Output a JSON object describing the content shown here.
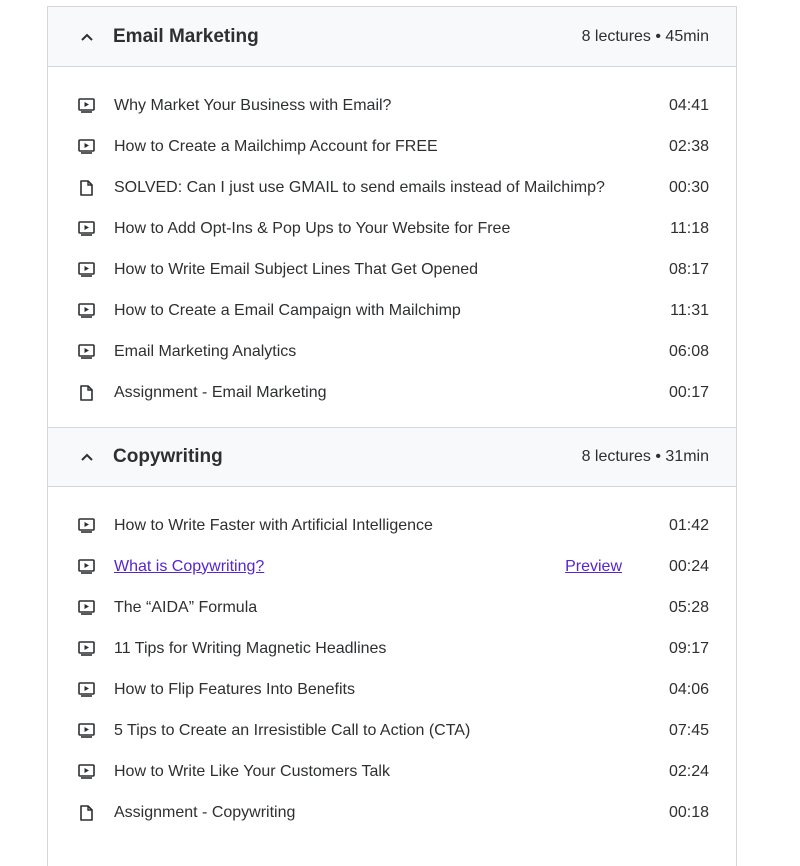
{
  "sections": [
    {
      "title": "Email Marketing",
      "meta": "8 lectures • 45min",
      "lectures": [
        {
          "icon": "video-icon",
          "title": "Why Market Your Business with Email?",
          "duration": "04:41"
        },
        {
          "icon": "video-icon",
          "title": "How to Create a Mailchimp Account for FREE",
          "duration": "02:38"
        },
        {
          "icon": "document-icon",
          "title": "SOLVED: Can I just use GMAIL to send emails instead of Mailchimp?",
          "duration": "00:30"
        },
        {
          "icon": "video-icon",
          "title": "How to Add Opt-Ins & Pop Ups to Your Website for Free",
          "duration": "11:18"
        },
        {
          "icon": "video-icon",
          "title": "How to Write Email Subject Lines That Get Opened",
          "duration": "08:17"
        },
        {
          "icon": "video-icon",
          "title": "How to Create a Email Campaign with Mailchimp",
          "duration": "11:31"
        },
        {
          "icon": "video-icon",
          "title": "Email Marketing Analytics",
          "duration": "06:08"
        },
        {
          "icon": "document-icon",
          "title": "Assignment - Email Marketing",
          "duration": "00:17"
        }
      ]
    },
    {
      "title": "Copywriting",
      "meta": "8 lectures • 31min",
      "lectures": [
        {
          "icon": "video-icon",
          "title": "How to Write Faster with Artificial Intelligence",
          "duration": "01:42"
        },
        {
          "icon": "video-icon",
          "title": "What is Copywriting?",
          "duration": "00:24",
          "preview": "Preview"
        },
        {
          "icon": "video-icon",
          "title": "The “AIDA” Formula",
          "duration": "05:28"
        },
        {
          "icon": "video-icon",
          "title": "11 Tips for Writing Magnetic Headlines",
          "duration": "09:17"
        },
        {
          "icon": "video-icon",
          "title": "How to Flip Features Into Benefits",
          "duration": "04:06"
        },
        {
          "icon": "video-icon",
          "title": "5 Tips to Create an Irresistible Call to Action (CTA)",
          "duration": "07:45"
        },
        {
          "icon": "video-icon",
          "title": "How to Write Like Your Customers Talk",
          "duration": "02:24"
        },
        {
          "icon": "document-icon",
          "title": "Assignment - Copywriting",
          "duration": "00:18"
        }
      ]
    }
  ],
  "colors": {
    "text": "#2d2f31",
    "link": "#5624d0",
    "header_bg": "#f7f9fa",
    "border": "#d1d7dc"
  }
}
